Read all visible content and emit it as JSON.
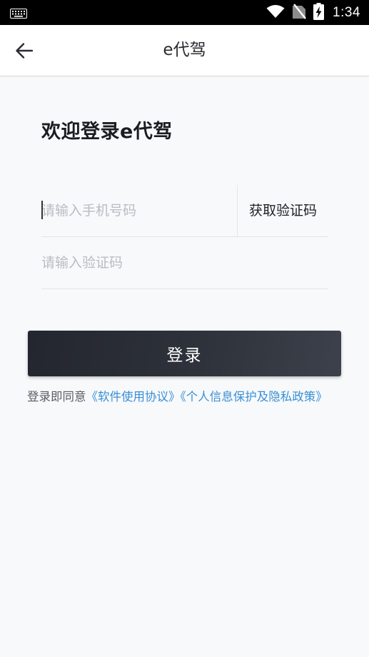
{
  "status_bar": {
    "time": "1:34",
    "icons": [
      "keyboard-icon",
      "wifi-icon",
      "no-sim-icon",
      "battery-charging-icon"
    ]
  },
  "app_bar": {
    "title": "e代驾",
    "back_icon": "arrow-left-icon"
  },
  "login": {
    "welcome": "欢迎登录e代驾",
    "phone_placeholder": "请输入手机号码",
    "get_code_label": "获取验证码",
    "code_placeholder": "请输入验证码",
    "login_label": "登录"
  },
  "agreement": {
    "prefix": "登录即同意",
    "software_agreement": "《软件使用协议》",
    "privacy_policy": "《个人信息保护及隐私政策》"
  },
  "colors": {
    "status_bar": "#000000",
    "background": "#f7f9fb",
    "button": "#2b2e36",
    "link": "#3a8fd6",
    "placeholder": "#b9bcc2"
  }
}
